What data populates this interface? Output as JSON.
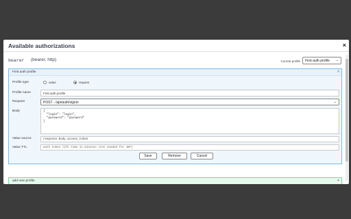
{
  "modal": {
    "title": "Available authorizations",
    "close": "×"
  },
  "auth": {
    "name": "bearer",
    "type": "(bearer, http)",
    "current_profile_label": "Current profile",
    "current_profile_value": "First auth profile"
  },
  "profile": {
    "header": "First auth profile",
    "profile_type_label": "Profile type",
    "profile_type_options": [
      "value",
      "request"
    ],
    "profile_type_selected": "request",
    "profile_name_label": "Profile name",
    "profile_name_value": "First auth profile",
    "request_label": "Request",
    "request_value": "POST - /api/auth/signin",
    "body_label": "Body",
    "body_value": "{\n  \"login\": \"login\",\n  \"password\": \"password\"\n}",
    "value_source_label": "Value source",
    "value_source_value": "response.body.access_token",
    "value_ttl_label": "Value TTL",
    "value_ttl_placeholder": "auth token life time in minutes (not needed for JWT)",
    "buttons": {
      "save": "Save",
      "remove": "Remove",
      "cancel": "Cancel"
    }
  },
  "add_profile": {
    "label": "add new profile",
    "plus": "+"
  },
  "icons": {
    "chevron": "chevron-down-icon",
    "collapse": "chevron-up-icon"
  }
}
